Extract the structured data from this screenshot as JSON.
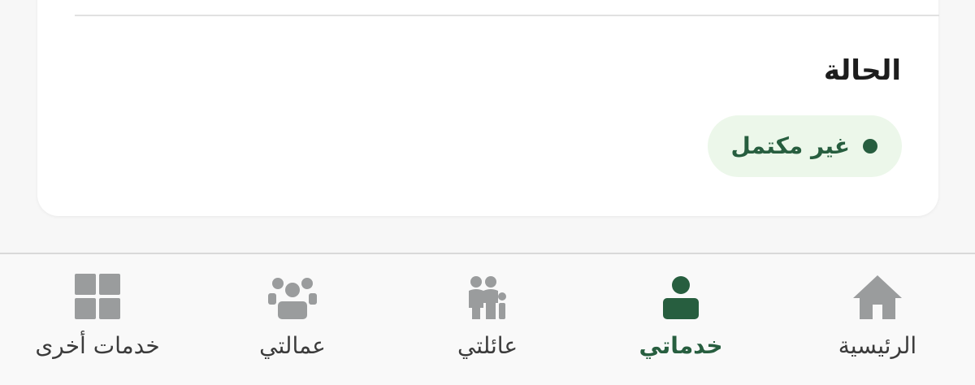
{
  "status_section": {
    "title": "الحالة",
    "status_text": "غير مكتمل"
  },
  "colors": {
    "accent": "#275e3f",
    "badge_bg": "#ecf7ea",
    "icon_inactive": "#9a9c9d",
    "icon_active": "#275e3f"
  },
  "bottom_nav": {
    "items": [
      {
        "label": "الرئيسية",
        "icon": "home-icon",
        "active": false
      },
      {
        "label": "خدماتي",
        "icon": "person-icon",
        "active": true
      },
      {
        "label": "عائلتي",
        "icon": "family-icon",
        "active": false
      },
      {
        "label": "عمالتي",
        "icon": "workers-icon",
        "active": false
      },
      {
        "label": "خدمات أخرى",
        "icon": "grid-icon",
        "active": false
      }
    ]
  }
}
